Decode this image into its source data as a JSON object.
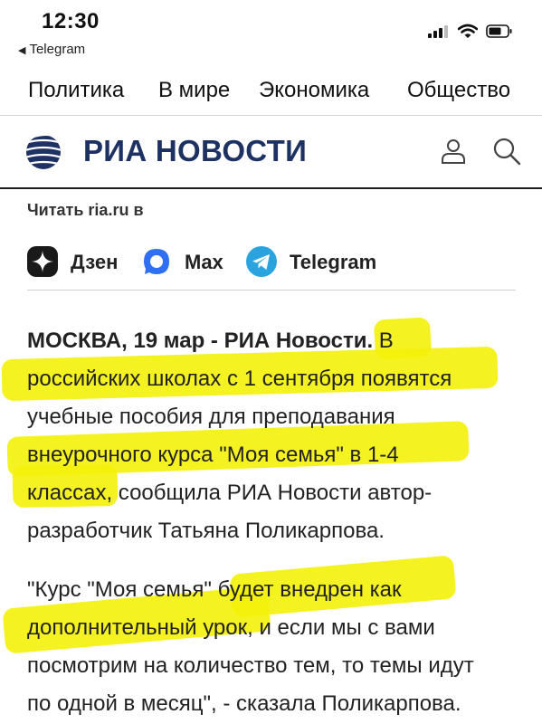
{
  "status_bar": {
    "time": "12:30",
    "back_app": "Telegram"
  },
  "nav": {
    "items": [
      "Политика",
      "В мире",
      "Экономика",
      "Общество"
    ]
  },
  "header": {
    "logo_text": "РИА НОВОСТИ"
  },
  "read_on": {
    "label": "Читать ria.ru в",
    "items": [
      {
        "label": "Дзен",
        "icon": "dzen-icon"
      },
      {
        "label": "Max",
        "icon": "max-icon"
      },
      {
        "label": "Telegram",
        "icon": "telegram-icon"
      }
    ]
  },
  "colors": {
    "brand": "#1d3263",
    "highlight": "#f4f10a",
    "telegram": "#2aa3df",
    "max": "#2f6ff4"
  },
  "article": {
    "p1": {
      "dateline": "МОСКВА, 19 мар - РИА Новости.",
      "line1_rest": " В",
      "line2": "российских школах с 1 сентября появятся",
      "line3": "учебные пособия для преподавания",
      "line4": "внеурочного курса \"Моя семья\" в 1-4",
      "line5": "классах, сообщила РИА Новости автор-",
      "line6": "разработчик Татьяна Поликарпова."
    },
    "p2": {
      "line1": "\"Курс \"Моя семья\" будет внедрен как",
      "line2": "дополнительный урок, и если мы с вами",
      "line3": "посмотрим на количество тем, то темы идут",
      "line4": "по одной в месяц\", - сказала Поликарпова."
    }
  }
}
